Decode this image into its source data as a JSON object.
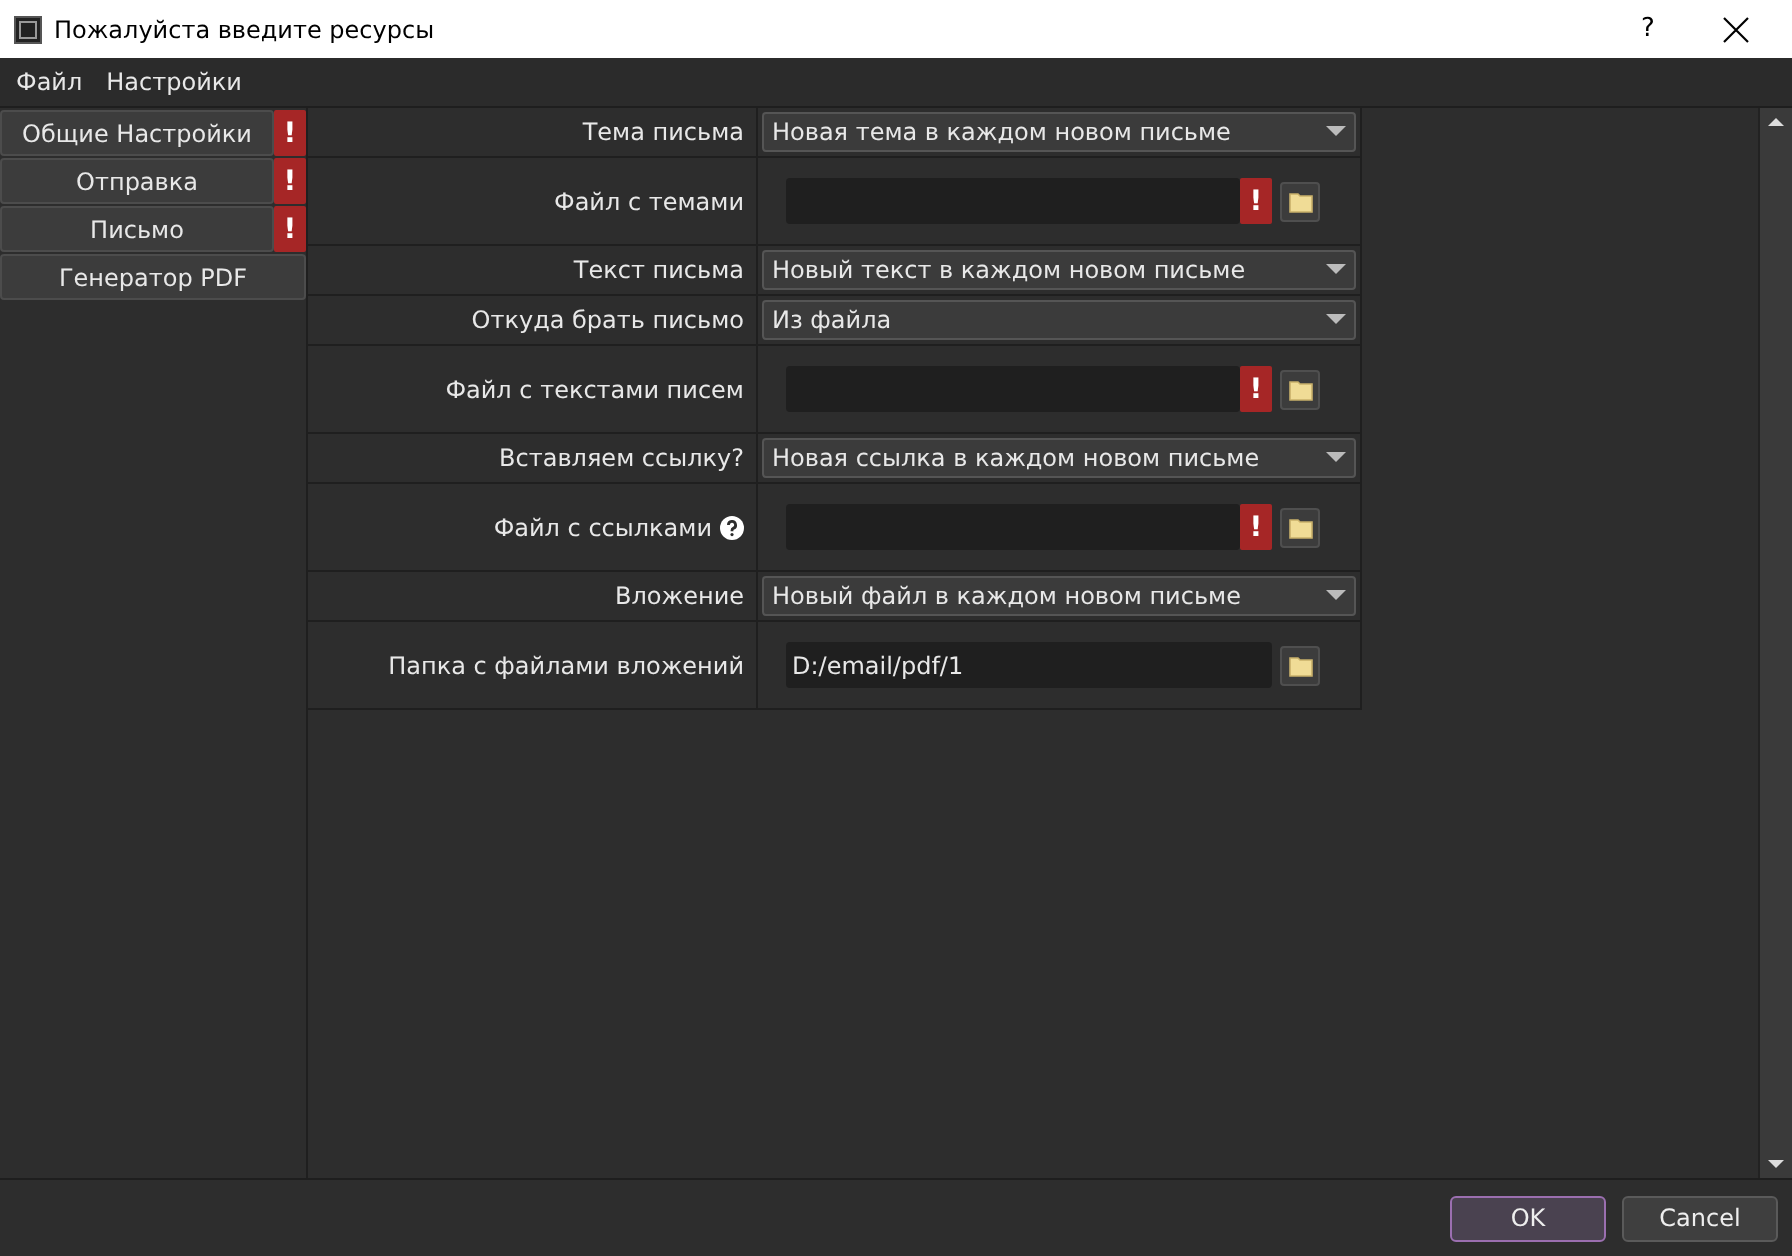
{
  "window": {
    "title": "Пожалуйста введите ресурсы",
    "help": "?"
  },
  "menu": [
    "Файл",
    "Настройки"
  ],
  "sidebar": {
    "items": [
      {
        "label": "Общие Настройки",
        "warning": true,
        "warning_mark": "!"
      },
      {
        "label": "Отправка",
        "warning": true,
        "warning_mark": "!"
      },
      {
        "label": "Письмо",
        "warning": true,
        "warning_mark": "!"
      },
      {
        "label": "Генератор PDF",
        "warning": false
      }
    ]
  },
  "form": {
    "rows": [
      {
        "kind": "select",
        "label": "Тема письма",
        "value": "Новая тема в каждом новом письме"
      },
      {
        "kind": "file",
        "label": "Файл с темами",
        "value": "",
        "help": false,
        "warning": true,
        "warning_mark": "!"
      },
      {
        "kind": "select",
        "label": "Текст письма",
        "value": "Новый текст в каждом новом письме"
      },
      {
        "kind": "select",
        "label": "Откуда брать письмо",
        "value": "Из файла"
      },
      {
        "kind": "file",
        "label": "Файл с текстами писем",
        "value": "",
        "help": false,
        "warning": true,
        "warning_mark": "!"
      },
      {
        "kind": "select",
        "label": "Вставляем ссылку?",
        "value": "Новая ссылка в каждом новом письме"
      },
      {
        "kind": "file",
        "label": "Файл с ссылками",
        "value": "",
        "help": true,
        "warning": true,
        "warning_mark": "!"
      },
      {
        "kind": "select",
        "label": "Вложение",
        "value": "Новый файл в каждом новом письме"
      },
      {
        "kind": "file",
        "label": "Папка с файлами вложений",
        "value": "D:/email/pdf/1",
        "help": false,
        "warning": false
      }
    ]
  },
  "buttons": [
    {
      "label": "OK",
      "default": true
    },
    {
      "label": "Cancel",
      "default": false
    }
  ]
}
